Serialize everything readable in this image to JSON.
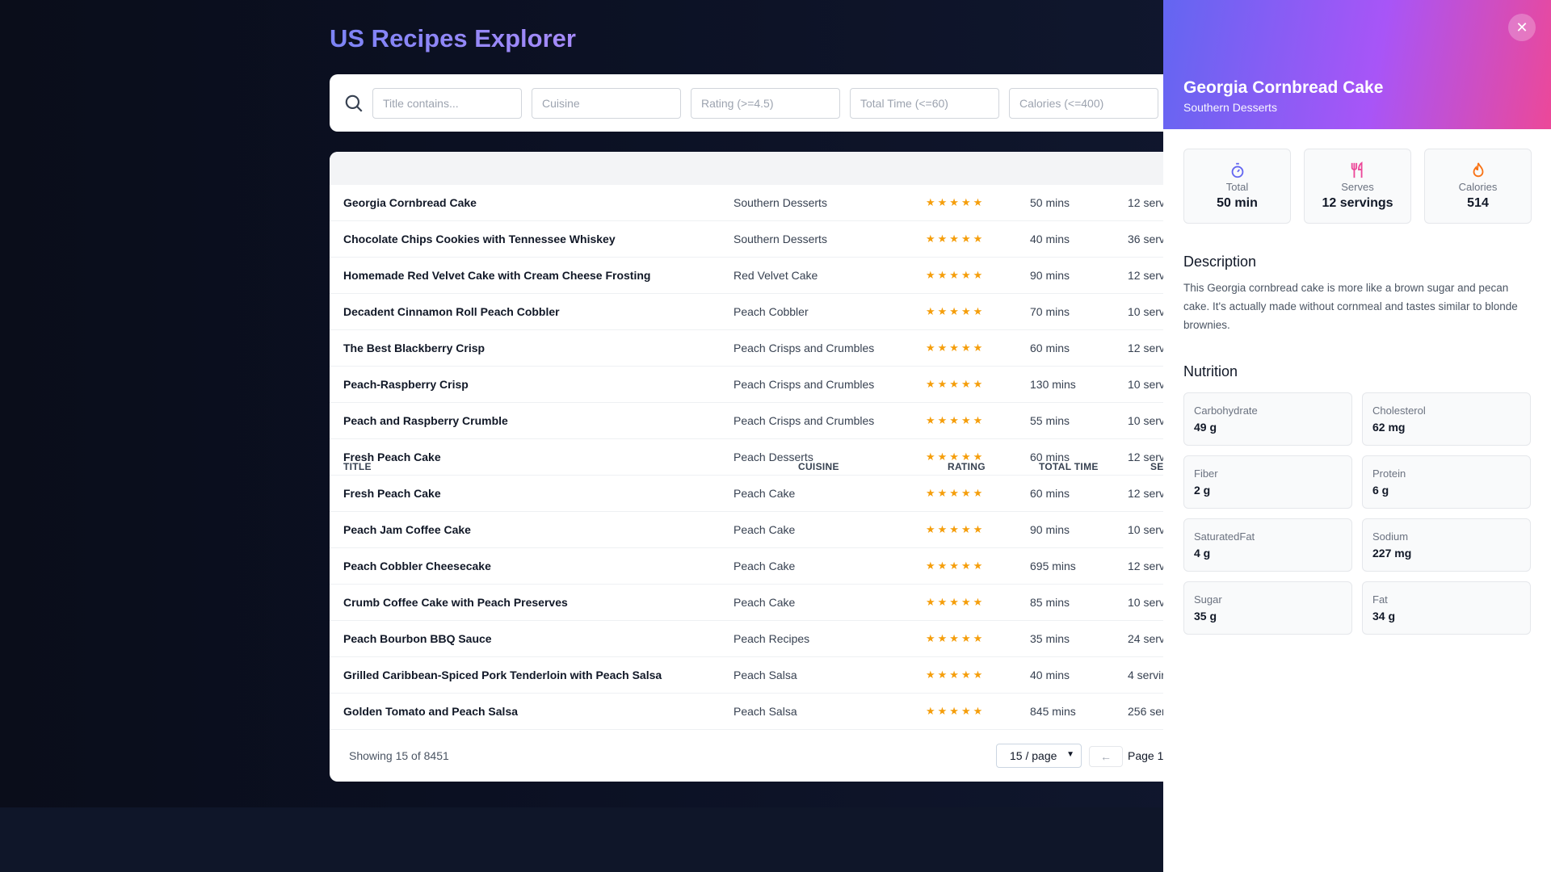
{
  "app": {
    "title": "US Recipes Explorer"
  },
  "filters": {
    "title_placeholder": "Title contains...",
    "cuisine_placeholder": "Cuisine",
    "rating_placeholder": "Rating (>=4.5)",
    "time_placeholder": "Total Time (<=60)",
    "calories_placeholder": "Calories (<=400)"
  },
  "table": {
    "headers": {
      "title": "TITLE",
      "cuisine": "CUISINE",
      "rating": "RATING",
      "time": "TOTAL TIME",
      "serves": "SEI"
    },
    "stars": "★★★★★",
    "rows": [
      {
        "title": "Georgia Cornbread Cake",
        "cuisine": "Southern Desserts",
        "time": "50 mins",
        "serves": "12 serv"
      },
      {
        "title": "Chocolate Chips Cookies with Tennessee Whiskey",
        "cuisine": "Southern Desserts",
        "time": "40 mins",
        "serves": "36 serv"
      },
      {
        "title": "Homemade Red Velvet Cake with Cream Cheese Frosting",
        "cuisine": "Red Velvet Cake",
        "time": "90 mins",
        "serves": "12 serv"
      },
      {
        "title": "Decadent Cinnamon Roll Peach Cobbler",
        "cuisine": "Peach Cobbler",
        "time": "70 mins",
        "serves": "10 serv"
      },
      {
        "title": "The Best Blackberry Crisp",
        "cuisine": "Peach Crisps and Crumbles",
        "time": "60 mins",
        "serves": "12 serv"
      },
      {
        "title": "Peach-Raspberry Crisp",
        "cuisine": "Peach Crisps and Crumbles",
        "time": "130 mins",
        "serves": "10 serv"
      },
      {
        "title": "Peach and Raspberry Crumble",
        "cuisine": "Peach Crisps and Crumbles",
        "time": "55 mins",
        "serves": "10 serv"
      },
      {
        "title": "Fresh Peach Cake",
        "cuisine": "Peach Desserts",
        "time": "60 mins",
        "serves": "12 serv"
      },
      {
        "title": "Fresh Peach Cake",
        "cuisine": "Peach Cake",
        "time": "60 mins",
        "serves": "12 serv"
      },
      {
        "title": "Peach Jam Coffee Cake",
        "cuisine": "Peach Cake",
        "time": "90 mins",
        "serves": "10 serv"
      },
      {
        "title": "Peach Cobbler Cheesecake",
        "cuisine": "Peach Cake",
        "time": "695 mins",
        "serves": "12 serv"
      },
      {
        "title": "Crumb Coffee Cake with Peach Preserves",
        "cuisine": "Peach Cake",
        "time": "85 mins",
        "serves": "10 serv"
      },
      {
        "title": "Peach Bourbon BBQ Sauce",
        "cuisine": "Peach Recipes",
        "time": "35 mins",
        "serves": "24 serv"
      },
      {
        "title": "Grilled Caribbean-Spiced Pork Tenderloin with Peach Salsa",
        "cuisine": "Peach Salsa",
        "time": "40 mins",
        "serves": "4 servir"
      },
      {
        "title": "Golden Tomato and Peach Salsa",
        "cuisine": "Peach Salsa",
        "time": "845 mins",
        "serves": "256 ser"
      }
    ],
    "footer": {
      "showing": "Showing 15 of 8451",
      "page_size": "15 / page",
      "prev": "←",
      "page": "Page 1"
    }
  },
  "panel": {
    "title": "Georgia Cornbread Cake",
    "subtitle": "Southern Desserts",
    "close": "✕",
    "stats": [
      {
        "label": "Total",
        "value": "50 min"
      },
      {
        "label": "Serves",
        "value": "12 servings"
      },
      {
        "label": "Calories",
        "value": "514"
      }
    ],
    "description_heading": "Description",
    "description": "This Georgia cornbread cake is more like a brown sugar and pecan cake. It's actually made without cornmeal and tastes similar to blonde brownies.",
    "nutrition_heading": "Nutrition",
    "nutrition": [
      {
        "label": "Carbohydrate",
        "value": "49 g"
      },
      {
        "label": "Cholesterol",
        "value": "62 mg"
      },
      {
        "label": "Fiber",
        "value": "2 g"
      },
      {
        "label": "Protein",
        "value": "6 g"
      },
      {
        "label": "SaturatedFat",
        "value": "4 g"
      },
      {
        "label": "Sodium",
        "value": "227 mg"
      },
      {
        "label": "Sugar",
        "value": "35 g"
      },
      {
        "label": "Fat",
        "value": "34 g"
      }
    ]
  },
  "colors": {
    "accent": "#6366f1",
    "star": "#f59e0b",
    "gradient_end": "#ec4899"
  }
}
